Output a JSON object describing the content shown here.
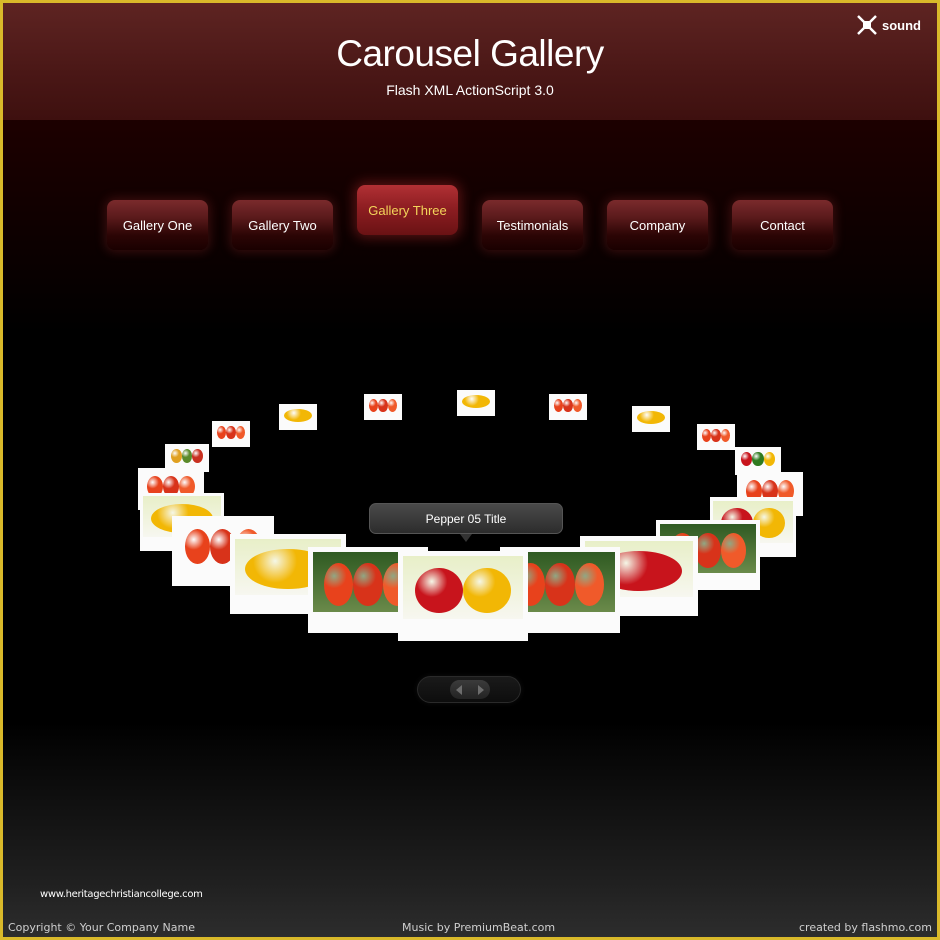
{
  "header": {
    "title": "Carousel Gallery",
    "subtitle": "Flash XML ActionScript 3.0",
    "sound_label": "sound",
    "sound_icon": "speaker-muted-x-icon"
  },
  "nav": {
    "active_index": 2,
    "active_color": "#f3d45a",
    "items": [
      {
        "label": "Gallery One"
      },
      {
        "label": "Gallery Two"
      },
      {
        "label": "Gallery Three"
      },
      {
        "label": "Testimonials"
      },
      {
        "label": "Company"
      },
      {
        "label": "Contact"
      }
    ]
  },
  "carousel": {
    "tooltip": "Pepper 05 Title",
    "items": [
      {
        "subject": "yellow peppers"
      },
      {
        "subject": "tomatoes on vine"
      },
      {
        "subject": "yellow pepper"
      },
      {
        "subject": "cherry tomatoes"
      },
      {
        "subject": "red green yellow peppers"
      },
      {
        "subject": "tomatoes"
      },
      {
        "subject": "yellow and red pepper"
      },
      {
        "subject": "tomatoes on vine"
      },
      {
        "subject": "red pepper"
      },
      {
        "subject": "tomatoes on vine"
      },
      {
        "subject": "red and yellow pepper"
      },
      {
        "subject": "tomatoes on vine"
      },
      {
        "subject": "yellow pepper half"
      },
      {
        "subject": "tomato"
      },
      {
        "subject": "yellow pepper halves"
      },
      {
        "subject": "cherry tomatoes"
      },
      {
        "subject": "mixed peppers"
      },
      {
        "subject": "tomatoes"
      },
      {
        "subject": "yellow chili peppers"
      },
      {
        "subject": "tomatoes on vine"
      }
    ]
  },
  "scroller": {
    "left_icon": "arrow-left-icon",
    "right_icon": "arrow-right-icon"
  },
  "footer": {
    "watermark": "www.heritagechristiancollege.com",
    "copyright": "Copyright © Your Company Name",
    "music": "Music by PremiumBeat.com",
    "credit": "created by flashmo.com"
  }
}
